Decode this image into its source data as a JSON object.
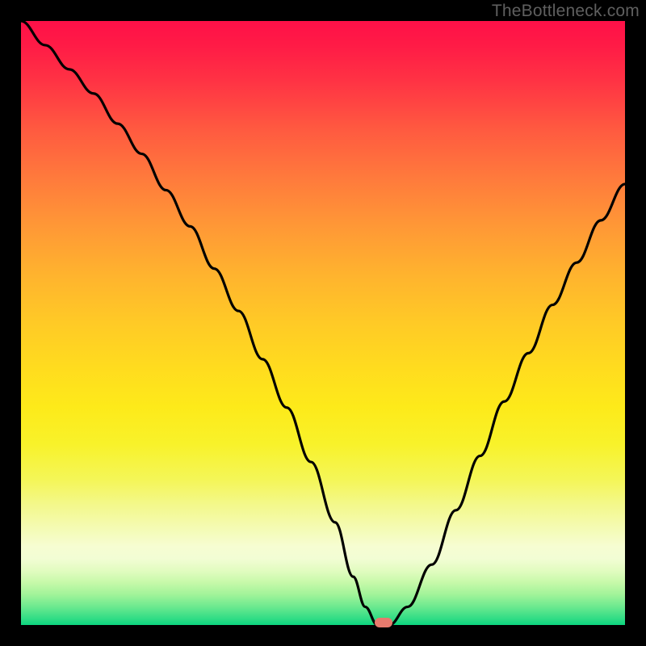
{
  "attribution": "TheBottleneck.com",
  "colors": {
    "frame": "#000000",
    "curve": "#000000",
    "marker": "#e77a6d",
    "gradient_top": "#ff1048",
    "gradient_mid": "#ffdd1e",
    "gradient_bottom": "#0cd57f"
  },
  "chart_data": {
    "type": "line",
    "title": "",
    "xlabel": "",
    "ylabel": "",
    "xlim": [
      0,
      100
    ],
    "ylim": [
      0,
      100
    ],
    "grid": false,
    "legend": false,
    "series": [
      {
        "name": "bottleneck-curve",
        "x": [
          0,
          4,
          8,
          12,
          16,
          20,
          24,
          28,
          32,
          36,
          40,
          44,
          48,
          52,
          55,
          57,
          59,
          61,
          64,
          68,
          72,
          76,
          80,
          84,
          88,
          92,
          96,
          100
        ],
        "y": [
          100,
          96,
          92,
          88,
          83,
          78,
          72,
          66,
          59,
          52,
          44,
          36,
          27,
          17,
          8,
          3,
          0,
          0,
          3,
          10,
          19,
          28,
          37,
          45,
          53,
          60,
          67,
          73
        ]
      }
    ],
    "marker": {
      "x": 60,
      "y": 0
    },
    "background_gradient": {
      "direction": "vertical",
      "stops": [
        {
          "pos": 0.0,
          "color": "#ff1048"
        },
        {
          "pos": 0.5,
          "color": "#ffca26"
        },
        {
          "pos": 0.85,
          "color": "#f4fbb4"
        },
        {
          "pos": 1.0,
          "color": "#0cd57f"
        }
      ]
    }
  }
}
